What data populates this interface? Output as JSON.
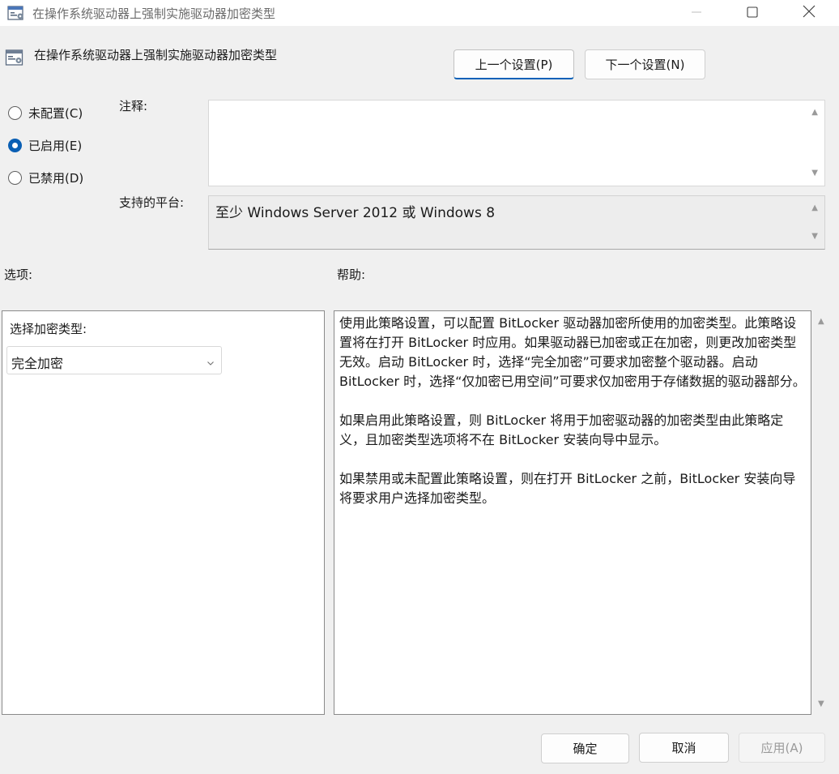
{
  "window": {
    "title": "在操作系统驱动器上强制实施驱动器加密类型"
  },
  "header": {
    "policy_title": "在操作系统驱动器上强制实施驱动器加密类型",
    "prev_label": "上一个设置(P)",
    "next_label": "下一个设置(N)"
  },
  "state": {
    "options": [
      {
        "label": "未配置(C)",
        "checked": false
      },
      {
        "label": "已启用(E)",
        "checked": true
      },
      {
        "label": "已禁用(D)",
        "checked": false
      }
    ]
  },
  "comment": {
    "label": "注释:",
    "value": ""
  },
  "platform": {
    "label": "支持的平台:",
    "value": "至少 Windows Server 2012 或 Windows 8"
  },
  "options_section": {
    "label": "选项:",
    "encryption_type_label": "选择加密类型:",
    "encryption_type_value": "完全加密"
  },
  "help_section": {
    "label": "帮助:",
    "text": "使用此策略设置，可以配置 BitLocker 驱动器加密所使用的加密类型。此策略设置将在打开 BitLocker 时应用。如果驱动器已加密或正在加密，则更改加密类型无效。启动 BitLocker 时，选择“完全加密”可要求加密整个驱动器。启动 BitLocker 时，选择“仅加密已用空间”可要求仅加密用于存储数据的驱动器部分。\n\n如果启用此策略设置，则 BitLocker 将用于加密驱动器的加密类型由此策略定义，且加密类型选项将不在 BitLocker 安装向导中显示。\n\n如果禁用或未配置此策略设置，则在打开 BitLocker 之前，BitLocker 安装向导将要求用户选择加密类型。"
  },
  "footer": {
    "ok_label": "确定",
    "cancel_label": "取消",
    "apply_label": "应用(A)"
  },
  "colors": {
    "accent": "#0a5fb4",
    "window_bg": "#f0f0f0",
    "disabled_text": "#9a9a9a"
  },
  "icons": [
    "policy-settings-icon",
    "minimize-icon",
    "maximize-icon",
    "close-icon",
    "chevron-down-icon",
    "scroll-up-arrow-icon",
    "scroll-down-arrow-icon"
  ]
}
